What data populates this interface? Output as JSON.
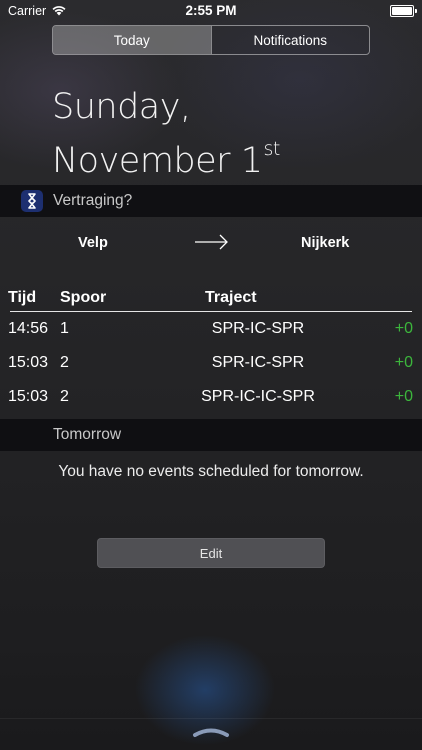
{
  "status_bar": {
    "carrier": "Carrier",
    "time": "2:55 PM",
    "icons": [
      "wifi-icon",
      "battery-icon"
    ]
  },
  "tabs": [
    {
      "label": "Today",
      "selected": true
    },
    {
      "label": "Notifications",
      "selected": false
    }
  ],
  "date": {
    "line1": "Sunday,",
    "line2": "November 1",
    "suffix": "st"
  },
  "widget": {
    "app_name": "Vertraging?",
    "app_icon": "vertraging-app-icon",
    "route": {
      "from": "Velp",
      "to": "Nijkerk",
      "arrow_icon": "right-arrow-icon"
    },
    "columns": [
      "Tijd",
      "Spoor",
      "Traject"
    ],
    "rows": [
      {
        "tijd": "14:56",
        "spoor": "1",
        "traject": "SPR-IC-SPR",
        "delay": "+0"
      },
      {
        "tijd": "15:03",
        "spoor": "2",
        "traject": "SPR-IC-SPR",
        "delay": "+0"
      },
      {
        "tijd": "15:03",
        "spoor": "2",
        "traject": "SPR-IC-IC-SPR",
        "delay": "+0"
      }
    ],
    "delay_color": "#3cb63c"
  },
  "tomorrow": {
    "title": "Tomorrow",
    "message": "You have no events scheduled for tomorrow."
  },
  "edit_button": "Edit",
  "bottom_grabber_icon": "chevron-up-grabber-icon"
}
